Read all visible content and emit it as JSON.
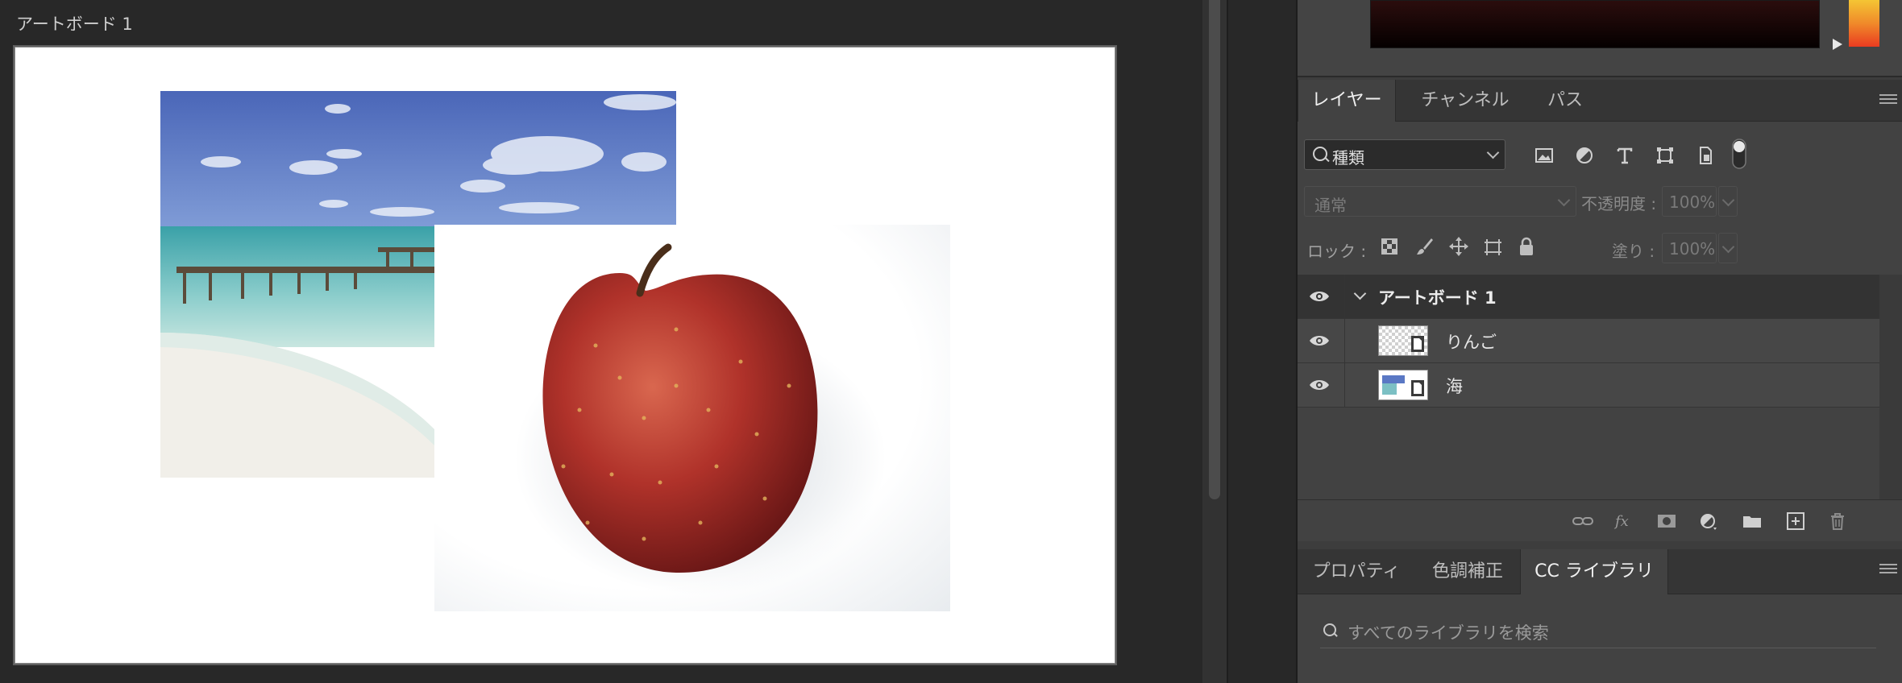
{
  "canvas": {
    "artboard_label": "アートボード 1"
  },
  "colors": {
    "accent_hue_top": "#f4c534",
    "accent_hue_bottom": "#ea3b20",
    "panel_bg": "#424242",
    "canvas_bg": "#282828"
  },
  "layers_panel": {
    "tabs": [
      "レイヤー",
      "チャンネル",
      "パス"
    ],
    "active_tab": "レイヤー",
    "filter": {
      "label": "種類"
    },
    "filter_icons": [
      "image-filter-icon",
      "adjustment-filter-icon",
      "type-filter-icon",
      "shape-filter-icon",
      "smart-object-filter-icon",
      "filter-toggle-icon"
    ],
    "blend_mode": "通常",
    "opacity_label": "不透明度 :",
    "opacity_value": "100%",
    "lock_label": "ロック :",
    "lock_icons": [
      "lock-transparent-icon",
      "lock-paint-icon",
      "lock-position-icon",
      "lock-artboard-icon",
      "lock-all-icon"
    ],
    "fill_label": "塗り :",
    "fill_value": "100%",
    "layers": [
      {
        "name": "アートボード 1",
        "type": "artboard",
        "visible": true,
        "expanded": true
      },
      {
        "name": "りんご",
        "type": "smart-object",
        "visible": true
      },
      {
        "name": "海",
        "type": "smart-object",
        "visible": true
      }
    ],
    "footer_icons": [
      "link-layers-icon",
      "fx-icon",
      "add-mask-icon",
      "adjustment-layer-icon",
      "new-group-icon",
      "new-layer-icon",
      "delete-layer-icon"
    ]
  },
  "library_panel": {
    "tabs": [
      "プロパティ",
      "色調補正",
      "CC ライブラリ"
    ],
    "active_tab": "CC ライブラリ",
    "search_placeholder": "すべてのライブラリを検索"
  }
}
